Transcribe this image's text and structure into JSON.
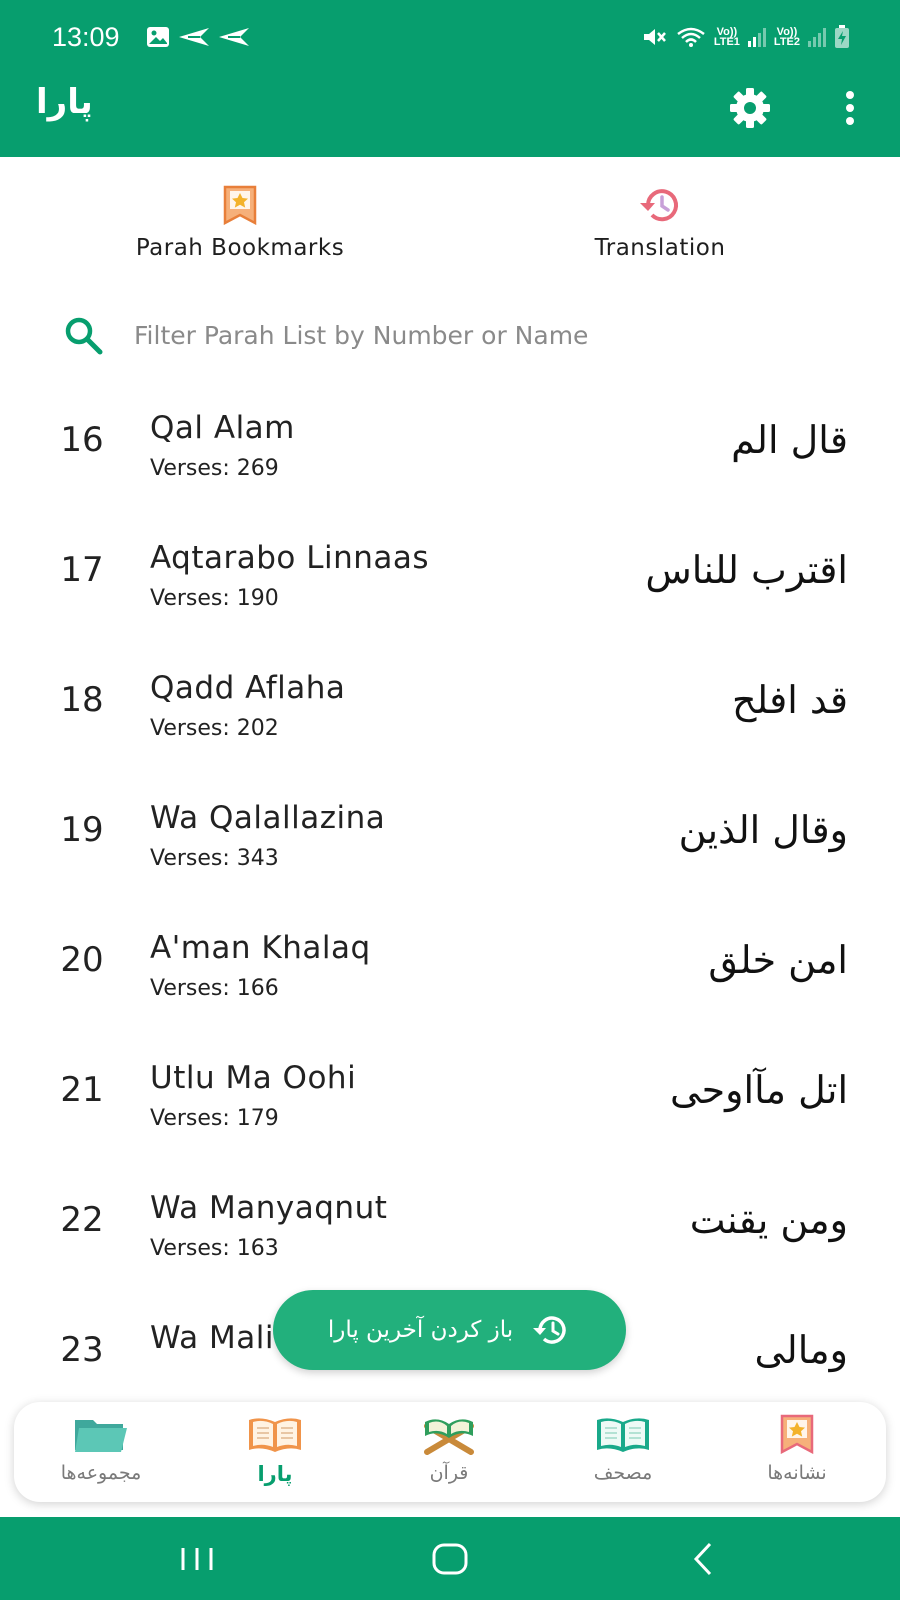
{
  "status_bar": {
    "time": "13:09",
    "sim1_label_top": "Vo))",
    "sim1_label_bottom": "LTE1",
    "sim2_label_top": "Vo))",
    "sim2_label_bottom": "LTE2",
    "icons": [
      "image-icon",
      "send-icon",
      "send-icon",
      "mute-icon",
      "wifi-icon",
      "signal-icon",
      "signal-icon",
      "battery-charging-icon"
    ]
  },
  "app_bar": {
    "title": "پارا",
    "background": "#079e6e",
    "icons": [
      "gear-icon",
      "more-vertical-icon"
    ]
  },
  "shortcuts": {
    "bookmarks_label": "Parah Bookmarks",
    "translation_label": "Translation"
  },
  "search": {
    "placeholder": "Filter Parah List by Number or Name",
    "value": ""
  },
  "parahs": [
    {
      "number": "16",
      "name": "Qal Alam",
      "verses": "Verses: 269",
      "arabic": "قال الم"
    },
    {
      "number": "17",
      "name": "Aqtarabo Linnaas",
      "verses": "Verses: 190",
      "arabic": "اقترب للناس"
    },
    {
      "number": "18",
      "name": "Qadd Aflaha",
      "verses": "Verses: 202",
      "arabic": "قد افلح"
    },
    {
      "number": "19",
      "name": "Wa Qalallazina",
      "verses": "Verses: 343",
      "arabic": "وقال الذين"
    },
    {
      "number": "20",
      "name": "A'man Khalaq",
      "verses": "Verses: 166",
      "arabic": "امن خلق"
    },
    {
      "number": "21",
      "name": "Utlu Ma Oohi",
      "verses": "Verses: 179",
      "arabic": "اتل مآاوحی"
    },
    {
      "number": "22",
      "name": "Wa Manyaqnut",
      "verses": "Verses: 163",
      "arabic": "ومن يقنت"
    },
    {
      "number": "23",
      "name": "Wa Mali",
      "verses": "",
      "arabic": "ومالی"
    }
  ],
  "resume_button": {
    "label": "باز کردن آخرین پارا"
  },
  "bottom_nav": {
    "items": [
      {
        "label": "مجموعه‌ها",
        "icon": "folder-icon",
        "active": false
      },
      {
        "label": "پارا",
        "icon": "open-book-icon",
        "active": true
      },
      {
        "label": "قرآن",
        "icon": "quran-stand-icon",
        "active": false
      },
      {
        "label": "مصحف",
        "icon": "open-book-icon",
        "active": false
      },
      {
        "label": "نشانه‌ها",
        "icon": "bookmark-star-icon",
        "active": false
      }
    ]
  },
  "colors": {
    "primary": "#079e6e",
    "fab": "#22b07c",
    "accent_orange": "#f0944a",
    "accent_pink": "#e8697a"
  }
}
